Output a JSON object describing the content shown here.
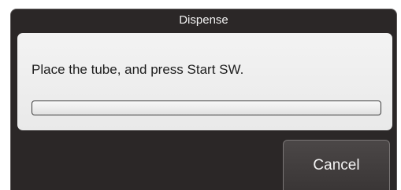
{
  "dialog": {
    "title": "Dispense",
    "message": "Place the tube, and press Start SW.",
    "progress_fraction": 0,
    "cancel_label": "Cancel"
  }
}
